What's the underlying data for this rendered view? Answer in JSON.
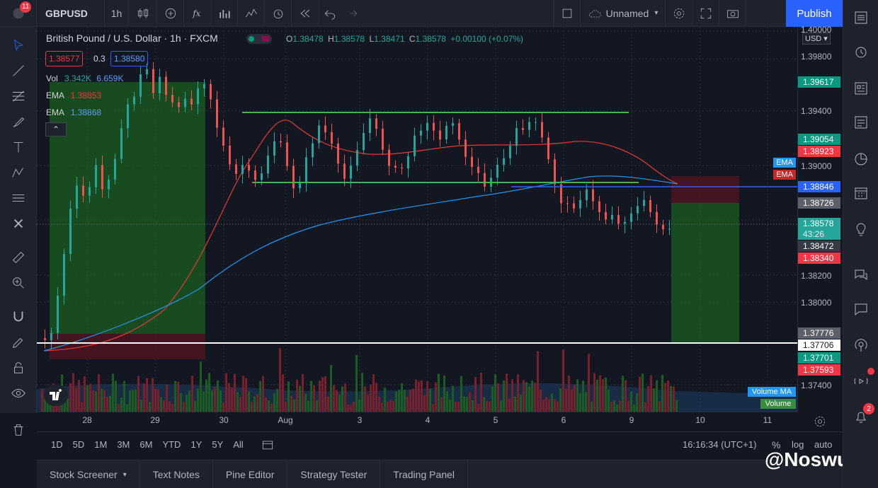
{
  "topbar": {
    "badge": "11",
    "symbol": "GBPUSD",
    "interval": "1h",
    "layout_name": "Unnamed",
    "publish_label": "Publish"
  },
  "header": {
    "title": "British Pound / U.S. Dollar · 1h · FXCM",
    "ohlc": {
      "o_label": "O",
      "o": "1.38478",
      "h_label": "H",
      "h": "1.38578",
      "l_label": "L",
      "l": "1.38471",
      "c_label": "C",
      "c": "1.38578",
      "change": "+0.00100 (+0.07%)"
    },
    "sell_price": "1.38577",
    "spread": "0.3",
    "buy_price": "1.38580"
  },
  "indicators": {
    "vol_label": "Vol",
    "vol_val1": "3.342K",
    "vol_val2": "6.659K",
    "ema1_label": "EMA",
    "ema1_val": "1.38853",
    "ema2_label": "EMA",
    "ema2_val": "1.38868"
  },
  "price_axis": {
    "currency": "USD",
    "labels": [
      "1.40000",
      "1.39800",
      "1.39400",
      "1.39000",
      "1.38200",
      "1.38000",
      "1.37400"
    ],
    "tags": [
      {
        "text": "1.39617",
        "color": "#089981"
      },
      {
        "text": "1.39054",
        "color": "#089981"
      },
      {
        "text": "1.38923",
        "color": "#f23645"
      },
      {
        "text": "1.38846",
        "color": "#2962ff"
      },
      {
        "text": "1.38726",
        "color": "#5d606b"
      },
      {
        "text": "1.38578",
        "color": "#26a69a"
      },
      {
        "text": "43:26",
        "color": "#26a69a"
      },
      {
        "text": "1.38472",
        "color": "#363a45"
      },
      {
        "text": "1.38340",
        "color": "#f23645"
      },
      {
        "text": "1.37776",
        "color": "#5d606b"
      },
      {
        "text": "1.37706",
        "color": "#ffffff"
      },
      {
        "text": "1.37701",
        "color": "#089981"
      },
      {
        "text": "1.37593",
        "color": "#f23645"
      }
    ],
    "ema_tag1": "EMA",
    "ema_tag2": "EMA",
    "volume_ma_tag": "Volume MA",
    "volume_tag": "Volume"
  },
  "time_axis": {
    "labels": [
      "28",
      "29",
      "30",
      "Aug",
      "3",
      "4",
      "5",
      "6",
      "9",
      "10",
      "11"
    ]
  },
  "bottom_toolbar": {
    "ranges": [
      "1D",
      "5D",
      "1M",
      "3M",
      "6M",
      "YTD",
      "1Y",
      "5Y",
      "All"
    ],
    "clock": "16:16:34 (UTC+1)",
    "percent": "%",
    "log": "log",
    "auto": "auto"
  },
  "tabs": [
    "Stock Screener",
    "Text Notes",
    "Pine Editor",
    "Strategy Tester",
    "Trading Panel"
  ],
  "watermark": "@Noswus",
  "right_badge": "2"
}
